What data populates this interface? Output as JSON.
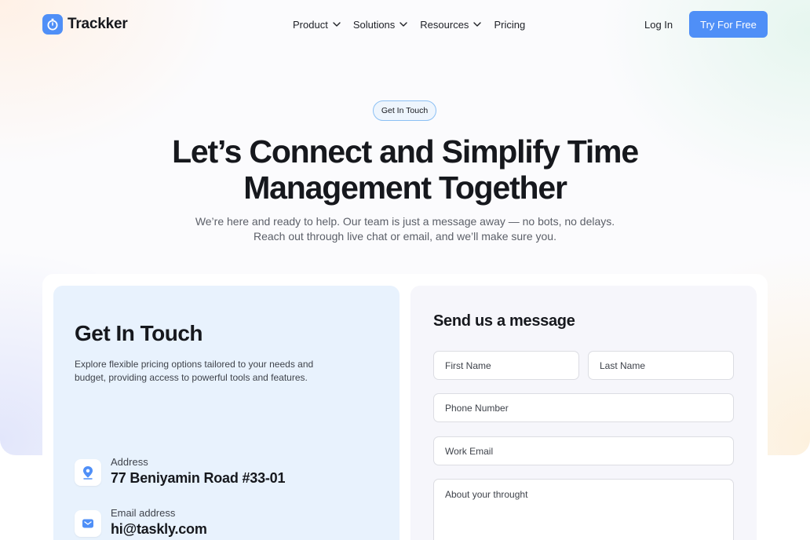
{
  "nav": {
    "brand": "Trackker",
    "menu": [
      {
        "label": "Product",
        "has_dropdown": true
      },
      {
        "label": "Solutions",
        "has_dropdown": true
      },
      {
        "label": "Resources",
        "has_dropdown": true
      },
      {
        "label": "Pricing",
        "has_dropdown": false
      }
    ],
    "login_label": "Log In",
    "cta_label": "Try For Free"
  },
  "hero": {
    "pill": "Get In Touch",
    "title_line1": "Let’s Connect and Simplify Time",
    "title_line2": "Management Together",
    "subtitle_line1": "We’re here and ready to help. Our team is just a message away — no bots, no delays.",
    "subtitle_line2": "Reach out through live chat or email, and we’ll make sure you."
  },
  "contact": {
    "title": "Get In Touch",
    "description": "Explore flexible pricing options tailored to your needs and budget, providing access to powerful tools and features.",
    "items": [
      {
        "label": "Address",
        "value": "77 Beniyamin Road #33-01",
        "icon": "location-pin-icon"
      },
      {
        "label": "Email address",
        "value": "hi@taskly.com",
        "icon": "mail-icon"
      }
    ]
  },
  "form": {
    "title": "Send us a message",
    "first_name_placeholder": "First Name",
    "last_name_placeholder": "Last Name",
    "phone_placeholder": "Phone Number",
    "email_placeholder": "Work Email",
    "message_placeholder": "About your throught"
  },
  "colors": {
    "accent": "#4f8ff7",
    "contact_card_bg": "#e8f2fd",
    "form_card_bg": "#f6f6fb",
    "text_dark": "#16181d"
  }
}
